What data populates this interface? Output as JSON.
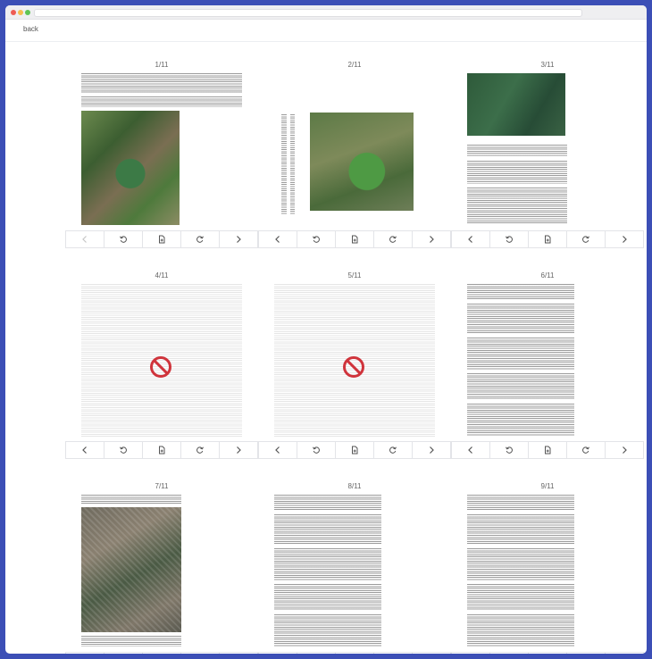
{
  "nav": {
    "back_label": "back"
  },
  "pages": [
    {
      "label": "1/11",
      "kind": "photo-doc",
      "photo": "sat1",
      "prev_disabled": true
    },
    {
      "label": "2/11",
      "kind": "rotated-doc",
      "photo": "sat2",
      "prev_disabled": false
    },
    {
      "label": "3/11",
      "kind": "table-photo-doc",
      "photo": "sat3",
      "prev_disabled": false
    },
    {
      "label": "4/11",
      "kind": "blocked",
      "prev_disabled": false
    },
    {
      "label": "5/11",
      "kind": "blocked",
      "prev_disabled": false
    },
    {
      "label": "6/11",
      "kind": "text-doc",
      "prev_disabled": false
    },
    {
      "label": "7/11",
      "kind": "city-doc",
      "photo": "city",
      "prev_disabled": false
    },
    {
      "label": "8/11",
      "kind": "text-doc",
      "prev_disabled": false
    },
    {
      "label": "9/11",
      "kind": "text-doc",
      "prev_disabled": false
    }
  ],
  "toolbar_icons": [
    "chevron-left-icon",
    "rotate-left-icon",
    "file-add-icon",
    "rotate-right-icon",
    "chevron-right-icon"
  ],
  "colors": {
    "frame": "#3c4fb6",
    "blocked": "#d0343c"
  }
}
